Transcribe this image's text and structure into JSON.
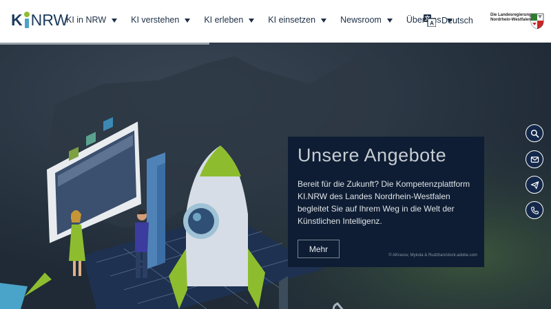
{
  "logo": {
    "k": "K",
    "nrw": "NRW"
  },
  "nav": {
    "items": [
      {
        "label": "KI in NRW"
      },
      {
        "label": "KI verstehen"
      },
      {
        "label": "KI erleben"
      },
      {
        "label": "KI einsetzen"
      },
      {
        "label": "Newsroom"
      },
      {
        "label": "Über uns"
      }
    ]
  },
  "language": {
    "label": "Deutsch"
  },
  "gov": {
    "line1": "Die Landesregierung",
    "line2": "Nordrhein-Westfalen"
  },
  "hero": {
    "title": "Unsere Angebote",
    "text": "Bereit für die Zukunft? Die Kompetenzplattform KI.NRW des Landes Nordrhein-Westfalen begleitet Sie auf Ihrem Weg in die Welt der Künstlichen Intelligenz.",
    "button": "Mehr",
    "credit": "© AKrasov, Mykola & Rudzhan/stock.adobe.com",
    "slide_progress": 0.38
  },
  "side_actions": [
    {
      "icon": "search-icon"
    },
    {
      "icon": "mail-icon"
    },
    {
      "icon": "send-icon"
    },
    {
      "icon": "phone-icon"
    }
  ],
  "colors": {
    "brand_dark": "#1b3a5c",
    "accent_green": "#8dbd2f",
    "accent_blue": "#4aa3c8",
    "panel": "#0e1d33"
  }
}
